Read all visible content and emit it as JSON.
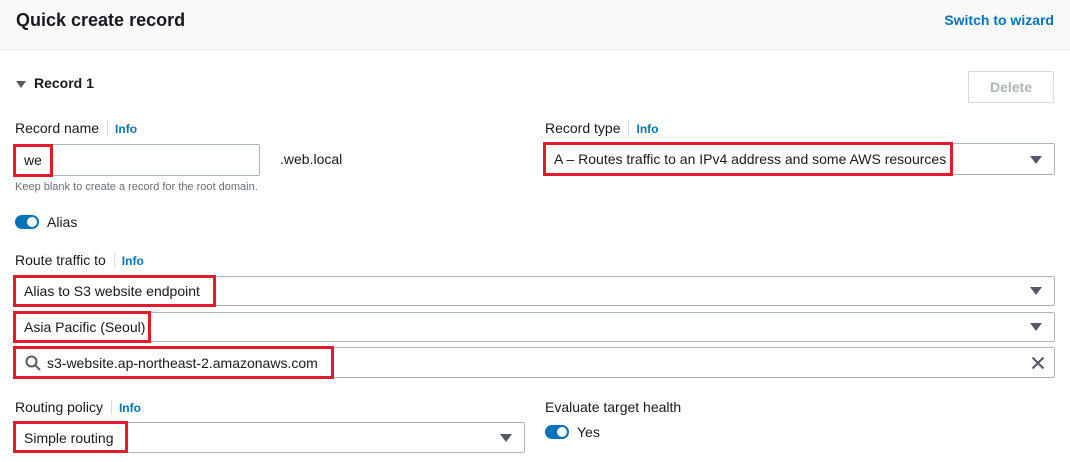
{
  "header": {
    "title": "Quick create record",
    "switch_label": "Switch to wizard"
  },
  "record": {
    "section_title": "Record 1",
    "delete_label": "Delete",
    "name": {
      "label": "Record name",
      "info": "Info",
      "value": "we",
      "suffix": ".web.local",
      "hint": "Keep blank to create a record for the root domain."
    },
    "type": {
      "label": "Record type",
      "info": "Info",
      "value": "A – Routes traffic to an IPv4 address and some AWS resources"
    },
    "alias": {
      "label": "Alias",
      "enabled": true
    },
    "route": {
      "label": "Route traffic to",
      "info": "Info",
      "endpoint_type": "Alias to S3 website endpoint",
      "region": "Asia Pacific (Seoul)",
      "endpoint": "s3-website.ap-northeast-2.amazonaws.com"
    },
    "routing_policy": {
      "label": "Routing policy",
      "info": "Info",
      "value": "Simple routing"
    },
    "health": {
      "label": "Evaluate target health",
      "toggle_label": "Yes",
      "enabled": true
    }
  },
  "colors": {
    "accent": "#0073bb",
    "highlight": "#e21a2e",
    "header_bg": "#fafafa"
  }
}
